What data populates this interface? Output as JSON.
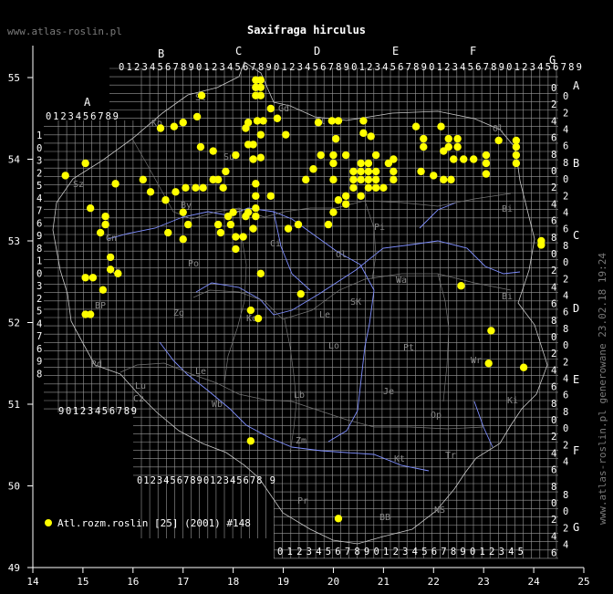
{
  "title": "Saxifraga hirculus",
  "site": "www.atlas-roslin.pl",
  "generated": "www.atlas-roslin.pl generowane 23.02.18 19:24",
  "legend": {
    "label": "Atl.rozm.roslin [25] (2001) #148"
  },
  "colors": {
    "background": "#000000",
    "grid": "#9a9a9a",
    "border": "#c8c8c8",
    "river": "#7f8fff",
    "dot": "#ffff00",
    "text": "#ffffff",
    "region": "#8a8a8a"
  },
  "chart_data": {
    "type": "scatter",
    "xlim": [
      14,
      25
    ],
    "ylim": [
      49,
      55.5
    ],
    "x_ticks": [
      "14",
      "15",
      "16",
      "17",
      "18",
      "19",
      "20",
      "21",
      "22",
      "23",
      "24",
      "25"
    ],
    "y_ticks": [
      "49",
      "50",
      "51",
      "52",
      "53",
      "54",
      "55"
    ],
    "top_columns": [
      "A",
      "B",
      "C",
      "D",
      "E",
      "F",
      "G"
    ],
    "right_rows": [
      "A",
      "B",
      "C",
      "D",
      "E",
      "F",
      "G"
    ],
    "grid_digits": "0123456789",
    "bottom_digits_left": "0123456789012345678 9",
    "bottom_digits_right": "01234567890123456789012345",
    "region_labels": [
      "Sl",
      "Ko",
      "Gd",
      "El",
      "Ol",
      "Su",
      "Sz",
      "Bi",
      "By",
      "To",
      "Pi",
      "Ci",
      "Ol",
      "Gn",
      "Wa",
      "Po",
      "Bi",
      "Ko",
      "SK",
      "BP",
      "Zg",
      "Le",
      "Lo",
      "Pt",
      "Rd",
      "Le",
      "Wr",
      "Lu",
      "Lb",
      "Je",
      "Cz",
      "Ki",
      "Wb",
      "Zm",
      "Op",
      "Kt",
      "Tr",
      "Pr",
      "BB",
      "NS",
      "Kr"
    ],
    "series": [
      {
        "name": "Atl.rozm.roslin [25] (2001) #148",
        "points": [
          [
            18.45,
            54.97
          ],
          [
            18.55,
            54.97
          ],
          [
            18.45,
            54.88
          ],
          [
            18.55,
            54.88
          ],
          [
            18.45,
            54.78
          ],
          [
            18.55,
            54.78
          ],
          [
            17.37,
            54.78
          ],
          [
            17.28,
            54.52
          ],
          [
            18.75,
            54.62
          ],
          [
            18.88,
            54.5
          ],
          [
            17.0,
            54.45
          ],
          [
            16.82,
            54.4
          ],
          [
            16.55,
            54.38
          ],
          [
            18.3,
            54.45
          ],
          [
            18.48,
            54.47
          ],
          [
            18.6,
            54.47
          ],
          [
            18.25,
            54.38
          ],
          [
            18.55,
            54.3
          ],
          [
            18.3,
            54.18
          ],
          [
            18.4,
            54.18
          ],
          [
            18.4,
            54.0
          ],
          [
            18.55,
            54.02
          ],
          [
            19.05,
            54.3
          ],
          [
            19.7,
            54.45
          ],
          [
            19.97,
            54.47
          ],
          [
            20.1,
            54.47
          ],
          [
            20.6,
            54.47
          ],
          [
            20.6,
            54.32
          ],
          [
            20.75,
            54.28
          ],
          [
            20.05,
            54.25
          ],
          [
            21.65,
            54.4
          ],
          [
            21.8,
            54.25
          ],
          [
            21.8,
            54.15
          ],
          [
            22.15,
            54.4
          ],
          [
            22.3,
            54.25
          ],
          [
            22.3,
            54.15
          ],
          [
            22.48,
            54.25
          ],
          [
            22.48,
            54.15
          ],
          [
            22.2,
            54.1
          ],
          [
            22.4,
            54.0
          ],
          [
            22.6,
            54.0
          ],
          [
            22.8,
            54.0
          ],
          [
            23.05,
            54.05
          ],
          [
            23.05,
            53.95
          ],
          [
            23.3,
            54.23
          ],
          [
            23.65,
            54.23
          ],
          [
            23.65,
            54.15
          ],
          [
            23.65,
            54.05
          ],
          [
            23.65,
            53.95
          ],
          [
            23.05,
            53.82
          ],
          [
            21.75,
            53.85
          ],
          [
            22.0,
            53.8
          ],
          [
            22.2,
            53.75
          ],
          [
            22.35,
            53.75
          ],
          [
            21.2,
            54.0
          ],
          [
            21.1,
            53.95
          ],
          [
            21.2,
            53.85
          ],
          [
            21.2,
            53.75
          ],
          [
            20.85,
            54.05
          ],
          [
            20.7,
            53.95
          ],
          [
            20.55,
            53.95
          ],
          [
            20.55,
            53.85
          ],
          [
            20.7,
            53.85
          ],
          [
            20.85,
            53.85
          ],
          [
            20.85,
            53.75
          ],
          [
            20.7,
            53.75
          ],
          [
            20.55,
            53.75
          ],
          [
            20.4,
            53.85
          ],
          [
            20.4,
            53.75
          ],
          [
            20.4,
            53.65
          ],
          [
            20.7,
            53.65
          ],
          [
            20.85,
            53.65
          ],
          [
            21.0,
            53.65
          ],
          [
            20.55,
            53.55
          ],
          [
            20.25,
            54.05
          ],
          [
            20.25,
            53.55
          ],
          [
            20.0,
            54.05
          ],
          [
            19.75,
            54.05
          ],
          [
            20.0,
            53.95
          ],
          [
            20.0,
            53.75
          ],
          [
            19.6,
            53.88
          ],
          [
            19.45,
            53.75
          ],
          [
            20.1,
            53.5
          ],
          [
            20.25,
            53.45
          ],
          [
            20.0,
            53.35
          ],
          [
            19.9,
            53.2
          ],
          [
            19.3,
            53.2
          ],
          [
            19.1,
            53.15
          ],
          [
            18.75,
            53.55
          ],
          [
            18.45,
            53.4
          ],
          [
            18.45,
            53.3
          ],
          [
            18.25,
            53.3
          ],
          [
            18.0,
            53.35
          ],
          [
            17.95,
            53.2
          ],
          [
            17.9,
            53.3
          ],
          [
            17.7,
            53.2
          ],
          [
            17.75,
            53.1
          ],
          [
            18.05,
            53.05
          ],
          [
            18.2,
            53.05
          ],
          [
            18.4,
            53.15
          ],
          [
            18.3,
            53.35
          ],
          [
            18.45,
            53.7
          ],
          [
            18.45,
            53.55
          ],
          [
            17.8,
            53.65
          ],
          [
            17.7,
            53.75
          ],
          [
            17.85,
            53.85
          ],
          [
            18.05,
            54.05
          ],
          [
            17.6,
            54.1
          ],
          [
            17.35,
            54.15
          ],
          [
            17.6,
            53.75
          ],
          [
            17.4,
            53.65
          ],
          [
            17.25,
            53.65
          ],
          [
            17.05,
            53.65
          ],
          [
            16.85,
            53.6
          ],
          [
            17.0,
            53.35
          ],
          [
            17.1,
            53.2
          ],
          [
            16.7,
            53.1
          ],
          [
            17.0,
            53.02
          ],
          [
            16.2,
            53.75
          ],
          [
            16.35,
            53.6
          ],
          [
            16.65,
            53.5
          ],
          [
            15.05,
            53.95
          ],
          [
            14.65,
            53.8
          ],
          [
            15.65,
            53.7
          ],
          [
            15.15,
            53.4
          ],
          [
            15.45,
            53.3
          ],
          [
            15.45,
            53.2
          ],
          [
            15.35,
            53.1
          ],
          [
            15.55,
            52.8
          ],
          [
            15.55,
            52.65
          ],
          [
            15.7,
            52.6
          ],
          [
            15.05,
            52.55
          ],
          [
            15.2,
            52.55
          ],
          [
            15.4,
            52.4
          ],
          [
            15.05,
            52.1
          ],
          [
            15.15,
            52.1
          ],
          [
            18.05,
            52.9
          ],
          [
            18.55,
            52.6
          ],
          [
            19.35,
            52.35
          ],
          [
            18.35,
            52.15
          ],
          [
            18.5,
            52.05
          ],
          [
            22.55,
            52.45
          ],
          [
            23.15,
            51.9
          ],
          [
            23.1,
            51.5
          ],
          [
            23.8,
            51.45
          ],
          [
            24.15,
            53.0
          ],
          [
            24.15,
            52.95
          ],
          [
            18.35,
            50.55
          ],
          [
            20.1,
            49.6
          ]
        ]
      }
    ]
  }
}
